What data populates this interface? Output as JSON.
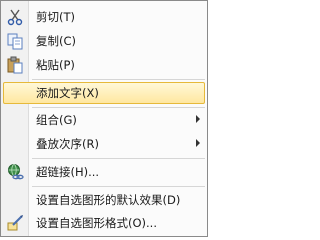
{
  "menu": {
    "items": [
      {
        "label": "剪切(T)",
        "icon": "scissors-icon"
      },
      {
        "label": "复制(C)",
        "icon": "copy-icon"
      },
      {
        "label": "粘贴(P)",
        "icon": "paste-icon"
      },
      {
        "label": "添加文字(X)",
        "highlighted": true
      },
      {
        "label": "组合(G)",
        "submenu": true
      },
      {
        "label": "叠放次序(R)",
        "submenu": true
      },
      {
        "label": "超链接(H)...",
        "icon": "hyperlink-icon"
      },
      {
        "label": "设置自选图形的默认效果(D)"
      },
      {
        "label": "设置自选图形格式(O)...",
        "icon": "format-shape-icon"
      }
    ]
  },
  "colors": {
    "highlight_top": "#fff8d8",
    "highlight_bottom": "#ffe7a0",
    "highlight_border": "#e6b93a"
  }
}
